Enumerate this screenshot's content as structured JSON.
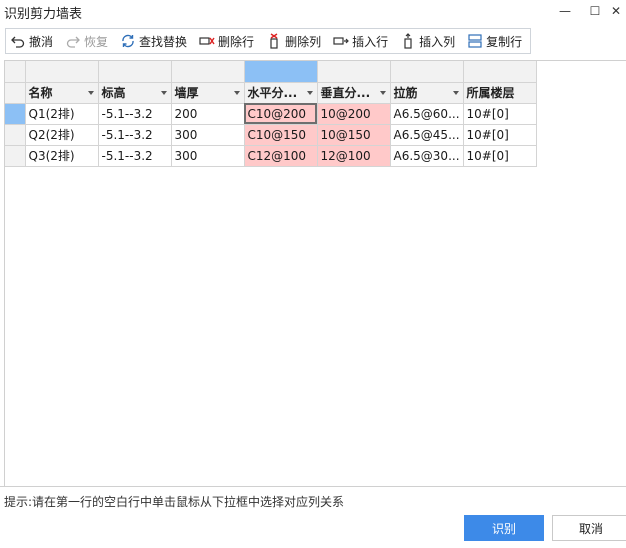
{
  "window": {
    "title": "识别剪力墙表",
    "minimize_glyph": "—",
    "maximize_glyph": "☐",
    "close_glyph": "✕"
  },
  "toolbar": {
    "undo": "撤消",
    "redo": "恢复",
    "find_replace": "查找替换",
    "delete_row": "删除行",
    "delete_col": "删除列",
    "insert_row": "插入行",
    "insert_col": "插入列",
    "copy_row": "复制行"
  },
  "table": {
    "columns": [
      "名称",
      "标高",
      "墙厚",
      "水平分...",
      "垂直分...",
      "拉筋",
      "所属楼层"
    ],
    "rows": [
      [
        "Q1(2排)",
        "-5.1--3.2",
        "200",
        "C10@200",
        "10@200",
        "A6.5@60...",
        "10#[0]"
      ],
      [
        "Q2(2排)",
        "-5.1--3.2",
        "300",
        "C10@150",
        "10@150",
        "A6.5@45...",
        "10#[0]"
      ],
      [
        "Q3(2排)",
        "-5.1--3.2",
        "300",
        "C12@100",
        "12@100",
        "A6.5@30...",
        "10#[0]"
      ]
    ]
  },
  "colors": {
    "highlight": "#ffc9c9",
    "selected_header": "#8cc0f5",
    "primary_button": "#3d8ae8"
  },
  "footer": {
    "hint": "提示:请在第一行的空白行中单击鼠标从下拉框中选择对应列关系",
    "ok_label": "识别",
    "cancel_label": "取消"
  }
}
